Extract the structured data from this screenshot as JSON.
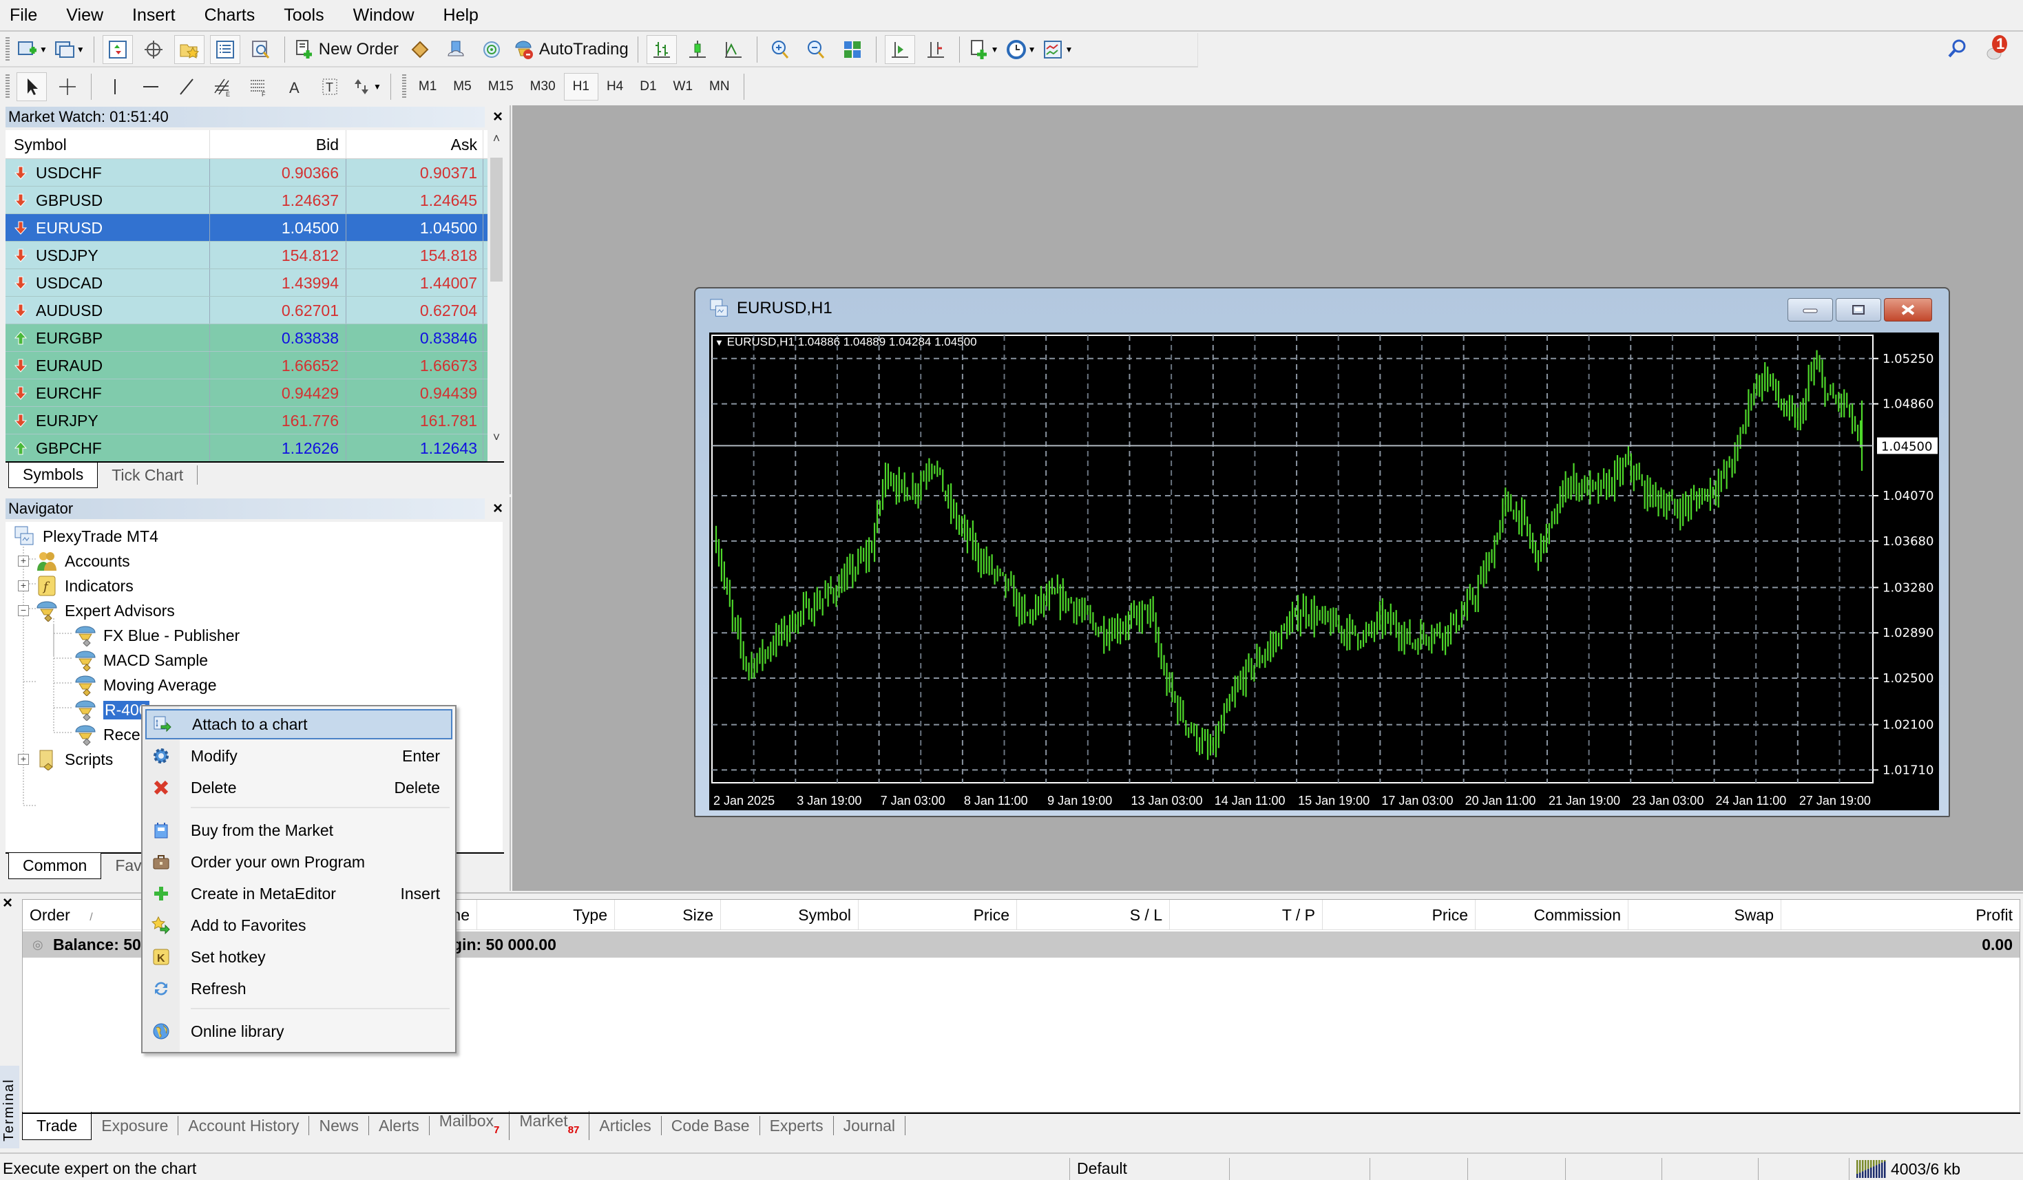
{
  "menu": [
    "File",
    "View",
    "Insert",
    "Charts",
    "Tools",
    "Window",
    "Help"
  ],
  "toolbar1": {
    "new_order_label": "New Order",
    "autotrading_label": "AutoTrading",
    "notification_count": "1"
  },
  "toolbar2": {
    "timeframes": [
      "M1",
      "M5",
      "M15",
      "M30",
      "H1",
      "H4",
      "D1",
      "W1",
      "MN"
    ],
    "active_timeframe": "H1"
  },
  "market_watch": {
    "title": "Market Watch: 01:51:40",
    "headers": {
      "symbol": "Symbol",
      "bid": "Bid",
      "ask": "Ask"
    },
    "rows": [
      {
        "symbol": "USDCHF",
        "bid": "0.90366",
        "ask": "0.90371",
        "dir": "down",
        "group": "a"
      },
      {
        "symbol": "GBPUSD",
        "bid": "1.24637",
        "ask": "1.24645",
        "dir": "down",
        "group": "a"
      },
      {
        "symbol": "EURUSD",
        "bid": "1.04500",
        "ask": "1.04500",
        "dir": "down",
        "group": "sel"
      },
      {
        "symbol": "USDJPY",
        "bid": "154.812",
        "ask": "154.818",
        "dir": "down",
        "group": "a"
      },
      {
        "symbol": "USDCAD",
        "bid": "1.43994",
        "ask": "1.44007",
        "dir": "down",
        "group": "a"
      },
      {
        "symbol": "AUDUSD",
        "bid": "0.62701",
        "ask": "0.62704",
        "dir": "down",
        "group": "a"
      },
      {
        "symbol": "EURGBP",
        "bid": "0.83838",
        "ask": "0.83846",
        "dir": "up",
        "group": "b"
      },
      {
        "symbol": "EURAUD",
        "bid": "1.66652",
        "ask": "1.66673",
        "dir": "down",
        "group": "b"
      },
      {
        "symbol": "EURCHF",
        "bid": "0.94429",
        "ask": "0.94439",
        "dir": "down",
        "group": "b"
      },
      {
        "symbol": "EURJPY",
        "bid": "161.776",
        "ask": "161.781",
        "dir": "down",
        "group": "b"
      },
      {
        "symbol": "GBPCHF",
        "bid": "1.12626",
        "ask": "1.12643",
        "dir": "up",
        "group": "b"
      }
    ],
    "tabs": [
      "Symbols",
      "Tick Chart"
    ],
    "colors": {
      "row_a": "#b8e0e4",
      "row_b": "#80cbac",
      "selected": "#3272d0",
      "down_text": "#d43030",
      "up_text": "#1010e0"
    }
  },
  "navigator": {
    "title": "Navigator",
    "root": "PlexyTrade MT4",
    "items": {
      "accounts": "Accounts",
      "indicators": "Indicators",
      "experts": "Expert Advisors",
      "ea1": "FX Blue - Publisher",
      "ea2": "MACD Sample",
      "ea3": "Moving Average",
      "ea4": "R-400",
      "ea5": "Recei",
      "scripts": "Scripts"
    },
    "tabs": [
      "Common",
      "Fav"
    ]
  },
  "chart_window": {
    "title": "EURUSD,H1",
    "info_line": "EURUSD,H1  1.04886 1.04889 1.04284 1.04500"
  },
  "chart_data": {
    "type": "bar",
    "title": "EURUSD,H1",
    "ohlc_last": {
      "open": 1.04886,
      "high": 1.04889,
      "low": 1.04284,
      "close": 1.045
    },
    "current_price": 1.045,
    "ylim": [
      1.016,
      1.0545
    ],
    "y_ticks": [
      "1.05250",
      "1.04860",
      "1.04070",
      "1.03680",
      "1.03280",
      "1.02890",
      "1.02500",
      "1.02100",
      "1.01710"
    ],
    "y_tick_values": [
      1.0525,
      1.0486,
      1.0407,
      1.0368,
      1.0328,
      1.0289,
      1.025,
      1.021,
      1.0171
    ],
    "x_ticks": [
      "2 Jan 2025",
      "3 Jan 19:00",
      "7 Jan 03:00",
      "8 Jan 11:00",
      "9 Jan 19:00",
      "13 Jan 03:00",
      "14 Jan 11:00",
      "15 Jan 19:00",
      "17 Jan 03:00",
      "20 Jan 11:00",
      "21 Jan 19:00",
      "23 Jan 03:00",
      "24 Jan 11:00",
      "27 Jan 19:00"
    ],
    "close_path": [
      1.037,
      1.03,
      1.026,
      1.027,
      1.0285,
      1.03,
      1.031,
      1.032,
      1.033,
      1.0345,
      1.036,
      1.043,
      1.041,
      1.0415,
      1.044,
      1.04,
      1.0375,
      1.0355,
      1.034,
      1.0325,
      1.03,
      1.0315,
      1.032,
      1.0315,
      1.03,
      1.029,
      1.0295,
      1.03,
      1.031,
      1.025,
      1.022,
      1.02,
      1.0185,
      1.022,
      1.025,
      1.0265,
      1.028,
      1.0295,
      1.031,
      1.03,
      1.0295,
      1.029,
      1.0285,
      1.03,
      1.0295,
      1.028,
      1.029,
      1.029,
      1.03,
      1.032,
      1.035,
      1.04,
      1.039,
      1.0355,
      1.038,
      1.042,
      1.0415,
      1.041,
      1.042,
      1.0435,
      1.041,
      1.0405,
      1.0395,
      1.04,
      1.041,
      1.042,
      1.0445,
      1.05,
      1.051,
      1.048,
      1.047,
      1.052,
      1.049,
      1.0486,
      1.045
    ],
    "series_color": "#4ed82a",
    "grid": true
  },
  "terminal": {
    "label": "Terminal",
    "headers": [
      "Order",
      "/",
      "Time",
      "Type",
      "Size",
      "Symbol",
      "Price",
      "S / L",
      "T / P",
      "Price",
      "Commission",
      "Swap",
      "Profit"
    ],
    "balance_left": "Balance: 50",
    "balance_mid": "gin: 50 000.00",
    "profit": "0.00",
    "tabs": [
      {
        "label": "Trade",
        "badge": ""
      },
      {
        "label": "Exposure",
        "badge": ""
      },
      {
        "label": "Account History",
        "badge": ""
      },
      {
        "label": "News",
        "badge": ""
      },
      {
        "label": "Alerts",
        "badge": ""
      },
      {
        "label": "Mailbox",
        "badge": "7"
      },
      {
        "label": "Market",
        "badge": "87"
      },
      {
        "label": "Articles",
        "badge": ""
      },
      {
        "label": "Code Base",
        "badge": ""
      },
      {
        "label": "Experts",
        "badge": ""
      },
      {
        "label": "Journal",
        "badge": ""
      }
    ]
  },
  "context_menu": {
    "items": [
      {
        "label": "Attach to a chart",
        "key": "",
        "icon": "attach-chart-icon"
      },
      {
        "label": "Modify",
        "key": "Enter",
        "icon": "gear-icon"
      },
      {
        "label": "Delete",
        "key": "Delete",
        "icon": "delete-x-icon"
      },
      {
        "label": "Buy from the Market",
        "key": "",
        "icon": "market-bag-icon"
      },
      {
        "label": "Order your own Program",
        "key": "",
        "icon": "briefcase-icon"
      },
      {
        "label": "Create in MetaEditor",
        "key": "Insert",
        "icon": "plus-icon"
      },
      {
        "label": "Add to Favorites",
        "key": "",
        "icon": "star-favorite-icon"
      },
      {
        "label": "Set hotkey",
        "key": "",
        "icon": "hotkey-k-icon"
      },
      {
        "label": "Refresh",
        "key": "",
        "icon": "refresh-icon"
      },
      {
        "label": "Online library",
        "key": "",
        "icon": "globe-icon"
      }
    ]
  },
  "status_bar": {
    "hint": "Execute expert on the chart",
    "profile": "Default",
    "traffic": "4003/6 kb"
  }
}
